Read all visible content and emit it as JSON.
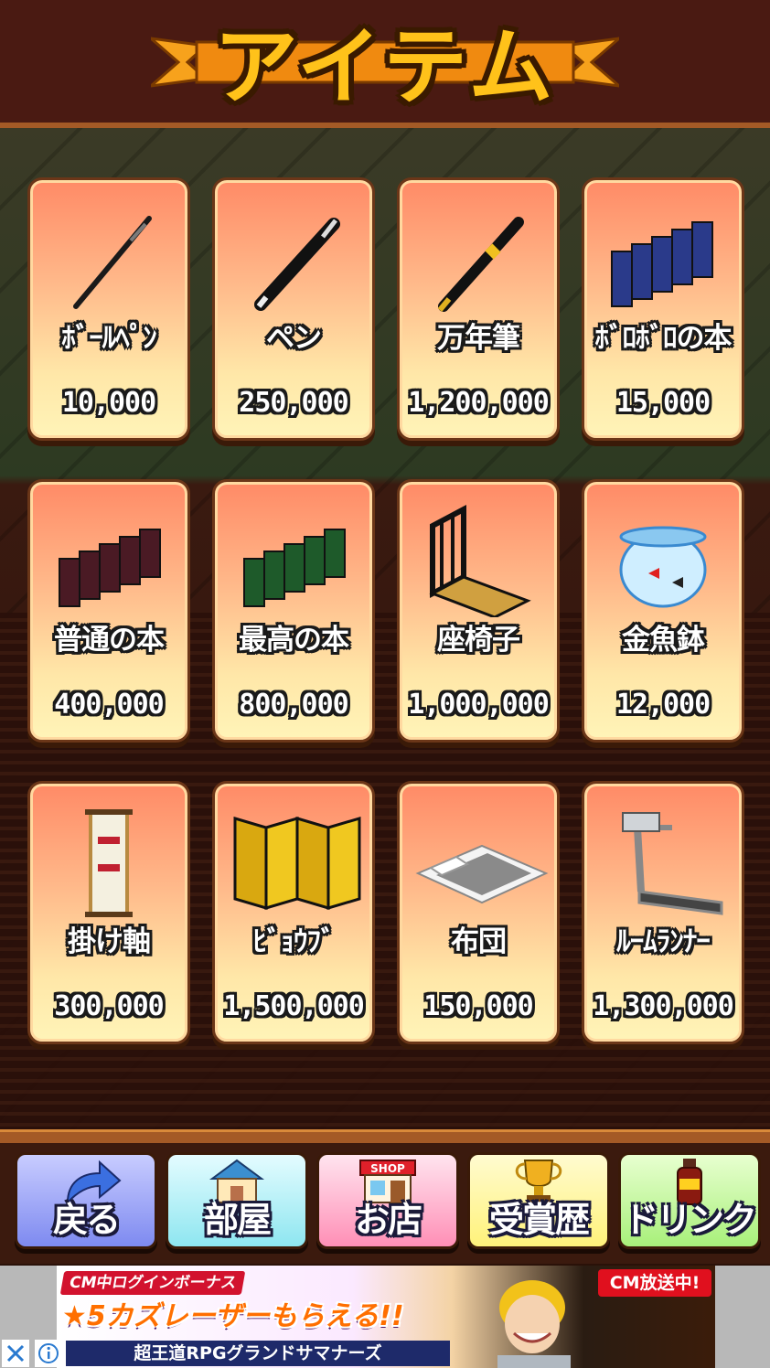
{
  "header": {
    "title": "アイテム"
  },
  "items": [
    {
      "name": "ﾎﾞｰﾙﾍﾟﾝ",
      "price": "10,000"
    },
    {
      "name": "ペン",
      "price": "250,000"
    },
    {
      "name": "万年筆",
      "price": "1,200,000"
    },
    {
      "name": "ﾎﾞﾛﾎﾞﾛの本",
      "price": "15,000"
    },
    {
      "name": "普通の本",
      "price": "400,000"
    },
    {
      "name": "最高の本",
      "price": "800,000"
    },
    {
      "name": "座椅子",
      "price": "1,000,000"
    },
    {
      "name": "金魚鉢",
      "price": "12,000"
    },
    {
      "name": "掛け軸",
      "price": "300,000"
    },
    {
      "name": "ﾋﾞｮｳﾌﾞ",
      "price": "1,500,000"
    },
    {
      "name": "布団",
      "price": "150,000"
    },
    {
      "name": "ﾙｰﾑﾗﾝﾅｰ",
      "price": "1,300,000"
    }
  ],
  "nav": [
    {
      "label": "戻る",
      "icon": "back-arrow-icon",
      "color": "#7e8af0"
    },
    {
      "label": "部屋",
      "icon": "house-icon",
      "color": "#8ee6f0"
    },
    {
      "label": "お店",
      "icon": "shop-icon",
      "icon_text": "SHOP",
      "color": "#ff8fb6"
    },
    {
      "label": "受賞歴",
      "icon": "trophy-icon",
      "color": "#fff27a"
    },
    {
      "label": "ドリンク",
      "icon": "drink-bottle-icon",
      "color": "#a8f07a"
    }
  ],
  "ad": {
    "tag": "CM中ログインボーナス",
    "headline": "★5カズレーザーもらえる!!",
    "sub": "超王道RPGグランドサマナーズ",
    "on_air": "CM放送中!"
  }
}
